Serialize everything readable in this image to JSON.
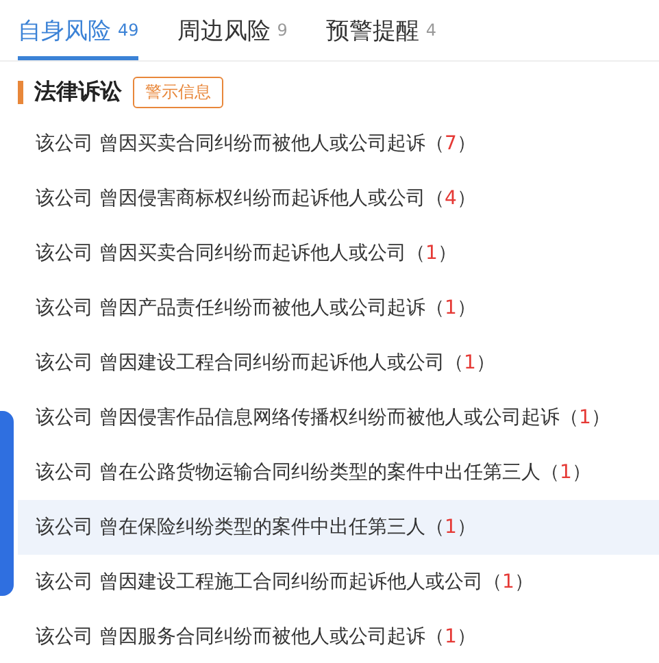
{
  "tabs": [
    {
      "label": "自身风险",
      "count": "49",
      "selected": true
    },
    {
      "label": "周边风险",
      "count": "9",
      "selected": false
    },
    {
      "label": "预警提醒",
      "count": "4",
      "selected": false
    }
  ],
  "section": {
    "title": "法律诉讼",
    "tag": "警示信息"
  },
  "rows": [
    {
      "subject": "该公司",
      "text": "曾因买卖合同纠纷而被他人或公司起诉",
      "open": "（",
      "count": "7",
      "close": "）",
      "selected": false
    },
    {
      "subject": "该公司",
      "text": "曾因侵害商标权纠纷而起诉他人或公司",
      "open": "（",
      "count": "4",
      "close": "）",
      "selected": false
    },
    {
      "subject": "该公司",
      "text": "曾因买卖合同纠纷而起诉他人或公司",
      "open": "（",
      "count": "1",
      "close": "）",
      "selected": false
    },
    {
      "subject": "该公司",
      "text": "曾因产品责任纠纷而被他人或公司起诉",
      "open": "（",
      "count": "1",
      "close": "）",
      "selected": false
    },
    {
      "subject": "该公司",
      "text": "曾因建设工程合同纠纷而起诉他人或公司",
      "open": "（",
      "count": "1",
      "close": "）",
      "selected": false
    },
    {
      "subject": "该公司",
      "text": "曾因侵害作品信息网络传播权纠纷而被他人或公司起诉",
      "open": "（",
      "count": "1",
      "close": "）",
      "selected": false
    },
    {
      "subject": "该公司",
      "text": "曾在公路货物运输合同纠纷类型的案件中出任第三人",
      "open": "（",
      "count": "1",
      "close": "）",
      "selected": false
    },
    {
      "subject": "该公司",
      "text": "曾在保险纠纷类型的案件中出任第三人",
      "open": "（",
      "count": "1",
      "close": "）",
      "selected": true
    },
    {
      "subject": "该公司",
      "text": "曾因建设工程施工合同纠纷而起诉他人或公司",
      "open": "（",
      "count": "1",
      "close": "）",
      "selected": false
    },
    {
      "subject": "该公司",
      "text": "曾因服务合同纠纷而被他人或公司起诉",
      "open": "（",
      "count": "1",
      "close": "）",
      "selected": false
    }
  ]
}
